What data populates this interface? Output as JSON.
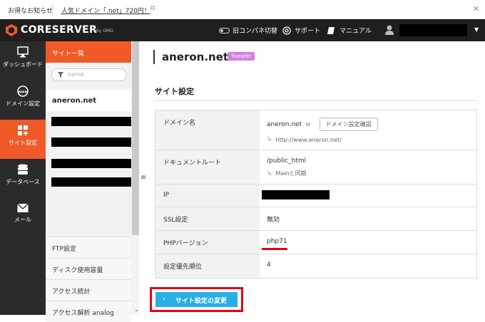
{
  "notice": {
    "label": "お得なお知らせ",
    "link": "人気ドメイン「.net」720円！"
  },
  "topbar": {
    "brand": "CORESERVER",
    "brand_sub": "by GMO",
    "theme_toggle": "旧コンパネ切替",
    "support": "サポート",
    "manual": "マニュアル"
  },
  "leftnav": [
    {
      "label": "ダッシュボード",
      "icon": "monitor-icon"
    },
    {
      "label": "ドメイン設定",
      "icon": "www-icon"
    },
    {
      "label": "サイト設定",
      "icon": "grid-plus-icon",
      "active": true
    },
    {
      "label": "データベース",
      "icon": "database-icon"
    },
    {
      "label": "メール",
      "icon": "mail-icon"
    }
  ],
  "subnav": {
    "head": "サイト一覧",
    "search_placeholder": "name",
    "selected_site": "aneron.net",
    "items": [
      "FTP設定",
      "ディスク使用容量",
      "アクセス統計",
      "アクセス解析 analog"
    ]
  },
  "main": {
    "site_name": "aneron.net",
    "badge": "Transfer",
    "section_title": "サイト設定",
    "rows": {
      "domain_label": "ドメイン名",
      "domain_value": "aneron.net",
      "domain_button": "ドメイン設定確認",
      "domain_url": "http://www.aneron.net/",
      "docroot_label": "ドキュメントルート",
      "docroot_value": "/public_html",
      "docroot_sync": "Mainと同期",
      "ip_label": "IP",
      "ssl_label": "SSL設定",
      "ssl_value": "無効",
      "php_label": "PHPバージョン",
      "php_value": "php71",
      "priority_label": "設定優先順位",
      "priority_value": "4"
    },
    "submit": "サイト設定の変更"
  },
  "colors": {
    "accent": "#f05a28",
    "button": "#29aee6",
    "highlight": "#e60012",
    "badge": "#d57fe0"
  }
}
